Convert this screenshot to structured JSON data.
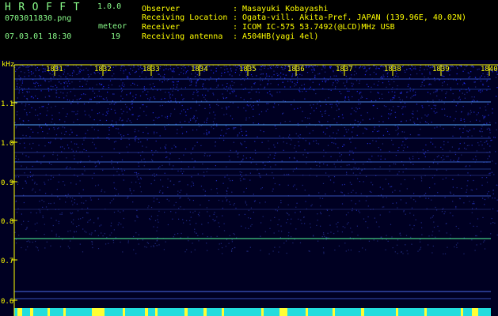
{
  "app": {
    "name": "HROFFT",
    "version": "1.0.0"
  },
  "left_panel": {
    "filename": "0703011830.png",
    "datetime": "07.03.01 18:30",
    "count_label": "meteor",
    "count_value": "19"
  },
  "info": {
    "observer_label": "Observer",
    "observer_value": ": Masayuki Kobayashi",
    "location_label": "Receiving Location",
    "location_value": ": Ogata-vill. Akita-Pref. JAPAN (139.96E, 40.02N)",
    "receiver_label": "Receiver",
    "receiver_value": ": ICOM IC-575 53.7492(@LCD)MHz USB",
    "antenna_label": "Receiving antenna",
    "antenna_value": ": A504HB(yagi 4el)"
  },
  "spectrogram": {
    "y_unit": "kHz",
    "freq_ticks": [
      "1.1",
      "1.0",
      "0.9",
      "0.8",
      "0.7",
      "0.6"
    ],
    "time_ticks": [
      "1831",
      "1832",
      "1833",
      "1834",
      "1835",
      "1836",
      "1837",
      "1838",
      "1839",
      "1840"
    ],
    "colors": {
      "background": "#000033",
      "axis": "#ffff00",
      "trace": "#66ccff",
      "carrier": "#55ff99"
    }
  }
}
